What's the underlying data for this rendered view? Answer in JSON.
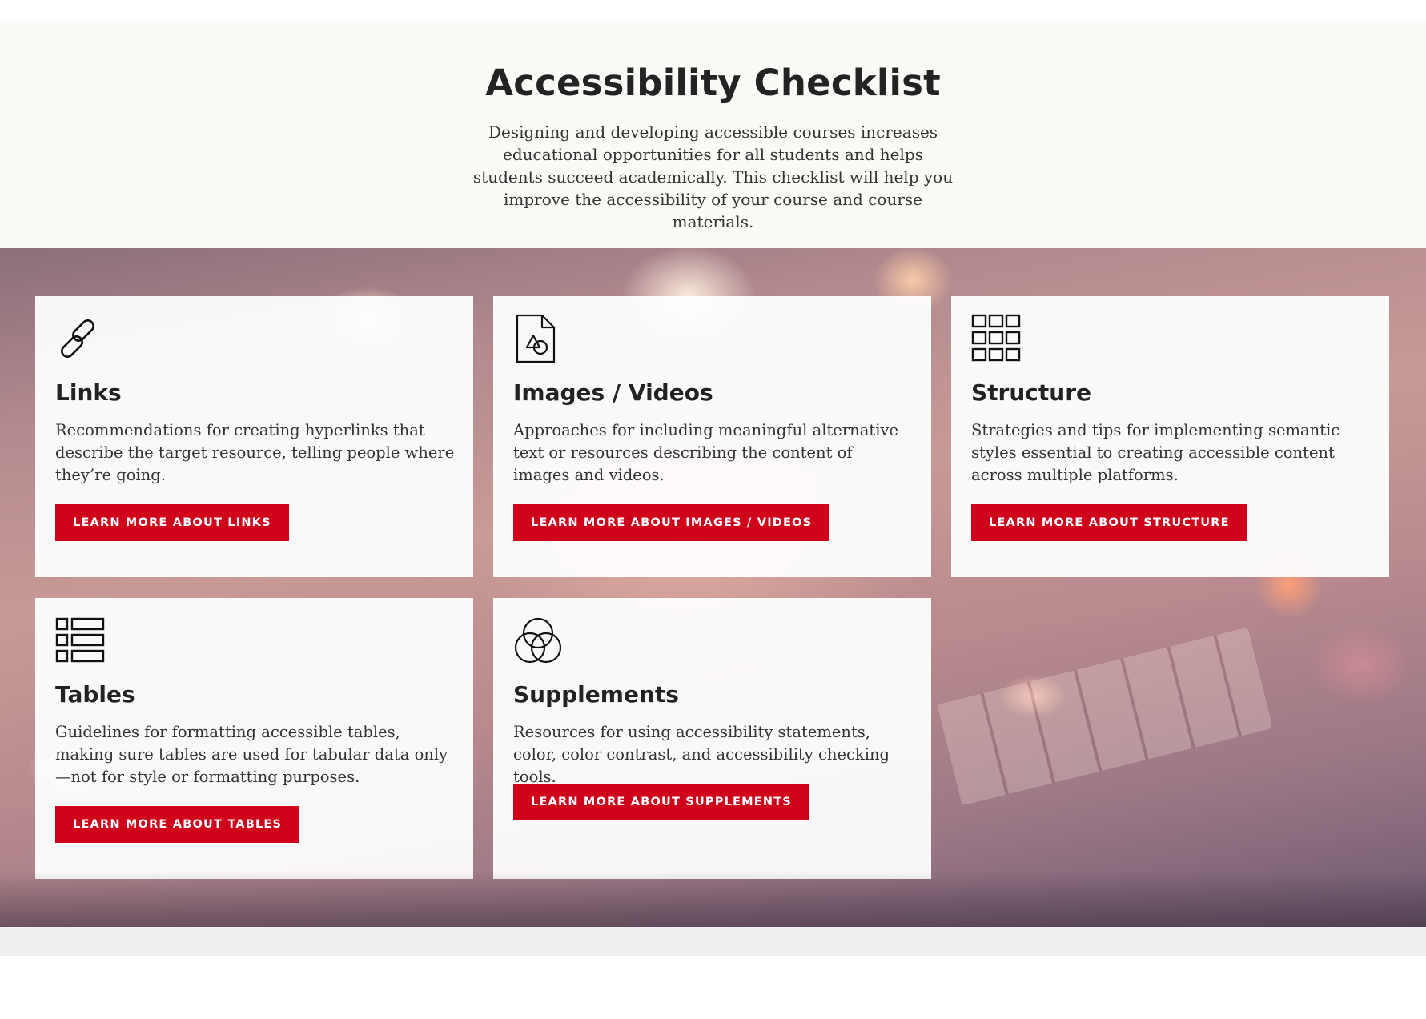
{
  "header": {
    "title": "Accessibility Checklist",
    "intro": "Designing and developing accessible courses increases educational opportunities for all students and helps students succeed academically. This checklist will help you improve the accessibility of your course and course materials."
  },
  "cards": [
    {
      "icon": "link-icon",
      "title": "Links",
      "description": "Recommendations for creating hyperlinks that describe the target resource, telling people where they’re going.",
      "button": "LEARN MORE ABOUT LINKS"
    },
    {
      "icon": "image-file-icon",
      "title": "Images / Videos",
      "description": "Approaches for including meaningful alternative text or resources describing the content of images and videos.",
      "button": "LEARN MORE ABOUT IMAGES / VIDEOS"
    },
    {
      "icon": "grid-icon",
      "title": "Structure",
      "description": "Strategies and tips for implementing semantic styles essential to creating accessible content across multiple platforms.",
      "button": "LEARN MORE ABOUT STRUCTURE"
    },
    {
      "icon": "table-list-icon",
      "title": "Tables",
      "description": "Guidelines for formatting accessible tables, making sure tables are used for tabular data only—not for style or formatting purposes.",
      "button": "LEARN MORE ABOUT TABLES"
    },
    {
      "icon": "venn-circles-icon",
      "title": "Supplements",
      "description": "Resources for using accessibility statements, color, color contrast, and accessibility checking tools.",
      "button": "LEARN MORE ABOUT SUPPLEMENTS"
    }
  ],
  "colors": {
    "accent": "#d0021b",
    "hero_background": "#fbfaf7",
    "text": "#222222"
  }
}
